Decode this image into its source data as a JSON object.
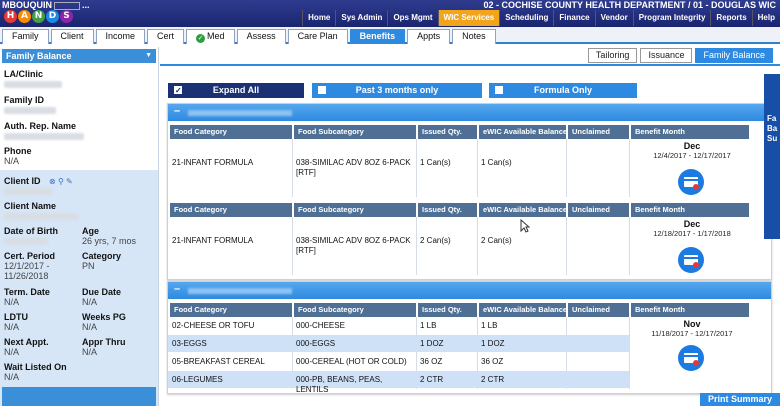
{
  "app": {
    "title": "MBOUQUIN",
    "title_suffix": "..."
  },
  "logo": {
    "letters": [
      "H",
      "A",
      "N",
      "D",
      "S"
    ],
    "colors": [
      "#e53935",
      "#fb8c00",
      "#43a047",
      "#1e88e5",
      "#8e24aa"
    ]
  },
  "header": {
    "agency": "02 - COCHISE COUNTY HEALTH DEPARTMENT / 01 - DOUGLAS WIC",
    "nav": [
      "Home",
      "Sys Admin",
      "Ops Mgmt",
      "WIC Services",
      "Scheduling",
      "Finance",
      "Vendor",
      "Program Integrity",
      "Reports",
      "Help"
    ],
    "active_nav": "WIC Services"
  },
  "tabs": [
    "Family",
    "Client",
    "Income",
    "Cert",
    "Med",
    "Assess",
    "Care Plan",
    "Benefits",
    "Appts",
    "Notes"
  ],
  "active_tab": "Benefits",
  "sidebar": {
    "title": "Family Balance",
    "la_clinic": {
      "label": "LA/Clinic"
    },
    "family_id": {
      "label": "Family ID"
    },
    "auth_rep": {
      "label": "Auth. Rep. Name"
    },
    "phone": {
      "label": "Phone",
      "value": "N/A"
    },
    "client_id": {
      "label": "Client ID"
    },
    "client_name": {
      "label": "Client Name"
    },
    "dob": {
      "label": "Date of Birth"
    },
    "age": {
      "label": "Age",
      "value": "26 yrs, 7 mos"
    },
    "cert_period": {
      "label": "Cert. Period",
      "value": "12/1/2017 - 11/26/2018"
    },
    "category": {
      "label": "Category",
      "value": "PN"
    },
    "term_date": {
      "label": "Term. Date",
      "value": "N/A"
    },
    "due_date": {
      "label": "Due Date",
      "value": "N/A"
    },
    "ldtu": {
      "label": "LDTU",
      "value": "N/A"
    },
    "weeks_pg": {
      "label": "Weeks PG",
      "value": "N/A"
    },
    "next_appt": {
      "label": "Next Appt.",
      "value": "N/A"
    },
    "appr_thru": {
      "label": "Appr Thru",
      "value": "N/A"
    },
    "wait_listed": {
      "label": "Wait Listed On",
      "value": "N/A"
    }
  },
  "subtabs": [
    "Tailoring",
    "Issuance",
    "Family Balance"
  ],
  "active_subtab": "Family Balance",
  "controls": {
    "expand_all": "Expand All",
    "past_3_months": "Past 3 months only",
    "formula_only": "Formula Only"
  },
  "table_headers": [
    "Food Category",
    "Food Subcategory",
    "Issued Qty.",
    "eWIC Available Balance",
    "Unclaimed",
    "Benefit Month"
  ],
  "sections": [
    {
      "collapse_symbol": "–",
      "blocks": [
        {
          "rows": [
            {
              "category": "21-INFANT FORMULA",
              "subcategory": "038-SIMILAC ADV 8OZ 6-PACK [RTF]",
              "issued": "1 Can(s)",
              "balance": "1 Can(s)",
              "unclaimed": ""
            }
          ],
          "month": "Dec",
          "range": "12/4/2017 - 12/17/2017"
        },
        {
          "rows": [
            {
              "category": "21-INFANT FORMULA",
              "subcategory": "038-SIMILAC ADV 8OZ 6-PACK [RTF]",
              "issued": "2 Can(s)",
              "balance": "2 Can(s)",
              "unclaimed": ""
            }
          ],
          "month": "Dec",
          "range": "12/18/2017 - 1/17/2018"
        }
      ]
    },
    {
      "collapse_symbol": "–",
      "blocks": [
        {
          "rows": [
            {
              "category": "02-CHEESE OR TOFU",
              "subcategory": "000-CHEESE",
              "issued": "1 LB",
              "balance": "1 LB",
              "unclaimed": ""
            },
            {
              "category": "03-EGGS",
              "subcategory": "000-EGGS",
              "issued": "1 DOZ",
              "balance": "1 DOZ",
              "unclaimed": ""
            },
            {
              "category": "05-BREAKFAST CEREAL",
              "subcategory": "000-CEREAL (HOT OR COLD)",
              "issued": "36 OZ",
              "balance": "36 OZ",
              "unclaimed": ""
            },
            {
              "category": "06-LEGUMES",
              "subcategory": "000-PB, BEANS, PEAS, LENTILS",
              "issued": "2 CTR",
              "balance": "2 CTR",
              "unclaimed": ""
            }
          ],
          "month": "Nov",
          "range": "11/18/2017 - 12/17/2017"
        }
      ]
    }
  ],
  "right_strip": "Fa Ba Su",
  "print_summary": "Print Summary"
}
